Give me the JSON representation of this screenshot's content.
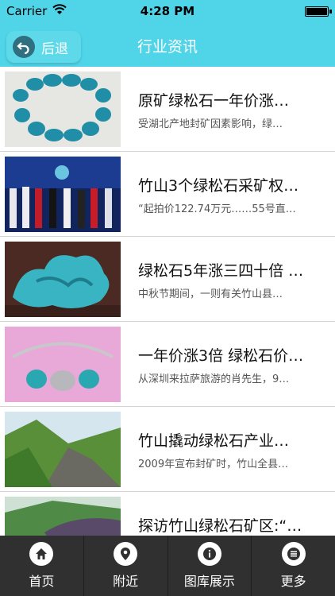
{
  "status": {
    "carrier": "Carrier",
    "time": "4:28 PM"
  },
  "nav": {
    "back_label": "后退",
    "title": "行业资讯"
  },
  "articles": [
    {
      "title": "原矿绿松石一年价涨…",
      "desc": "受湖北产地封矿因素影响，绿…"
    },
    {
      "title": "竹山3个绿松石采矿权…",
      "desc": "“起拍价122.74万元……55号直…"
    },
    {
      "title": "绿松石5年涨三四十倍 …",
      "desc": "中秋节期间，一则有关竹山县…"
    },
    {
      "title": "一年价涨3倍 绿松石价…",
      "desc": "从深圳来拉萨旅游的肖先生，9…"
    },
    {
      "title": "竹山撬动绿松石产业…",
      "desc": "2009年宣布封矿时，竹山全县…"
    },
    {
      "title": "探访竹山绿松石矿区:“…",
      "desc": ""
    }
  ],
  "tabs": [
    {
      "label": "首页",
      "icon": "home-icon"
    },
    {
      "label": "附近",
      "icon": "location-pin-icon"
    },
    {
      "label": "图库展示",
      "icon": "info-icon"
    },
    {
      "label": "更多",
      "icon": "list-icon"
    }
  ],
  "colors": {
    "nav": "#4fd4e8",
    "tabbar": "#303030"
  }
}
